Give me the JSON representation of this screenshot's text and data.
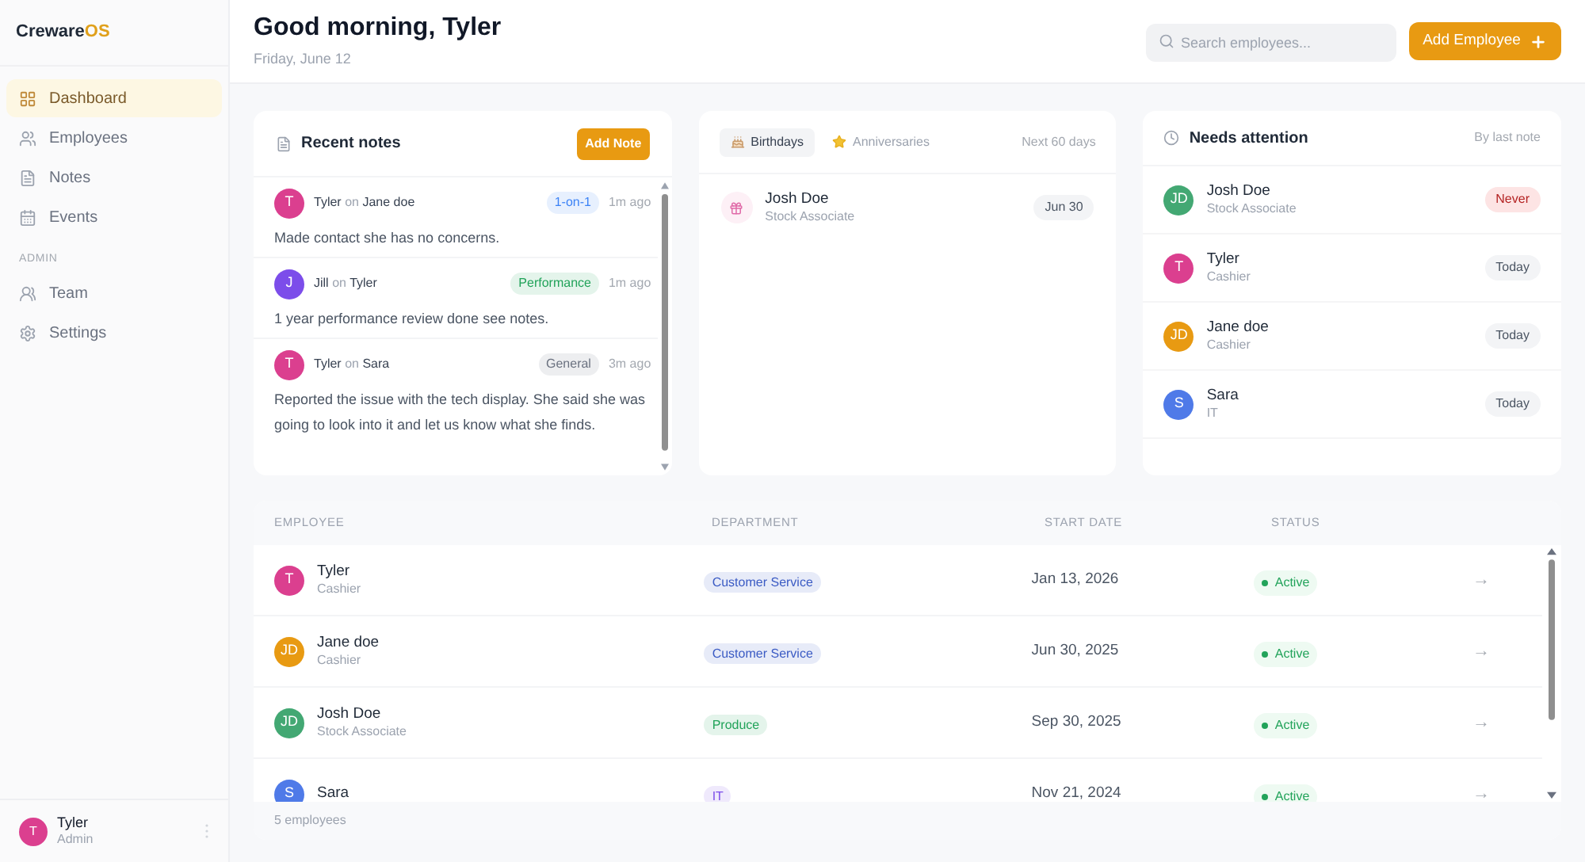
{
  "brand": {
    "name": "Creware",
    "suffix": "OS"
  },
  "sidebar": {
    "items": [
      {
        "label": "Dashboard",
        "selected": true
      },
      {
        "label": "Employees",
        "selected": false
      },
      {
        "label": "Notes",
        "selected": false
      },
      {
        "label": "Events",
        "selected": false
      }
    ],
    "section": "ADMIN",
    "admin_items": [
      {
        "label": "Team",
        "selected": false
      },
      {
        "label": "Settings",
        "selected": false
      }
    ],
    "user": {
      "initials": "T",
      "name": "Tyler",
      "role": "Admin",
      "color": "#db3f8f"
    }
  },
  "header": {
    "greeting": "Good morning, Tyler",
    "date": "Friday, June 12",
    "search": {
      "placeholder": "Search employees..."
    },
    "add_button": "Add Employee"
  },
  "recent_notes": {
    "title": "Recent notes",
    "add_button": "Add Note",
    "items": [
      {
        "initials": "T",
        "color": "#db3f8f",
        "author": "Tyler",
        "on": "on",
        "subject": "Jane doe",
        "tag": {
          "label": "1-on-1",
          "color": "#3b82f6"
        },
        "time": "1m ago",
        "text": "Made contact she has no concerns."
      },
      {
        "initials": "J",
        "color": "#7c4dea",
        "author": "Jill",
        "on": "on",
        "subject": "Tyler",
        "tag": {
          "label": "Performance",
          "color": "#22a35a"
        },
        "time": "1m ago",
        "text": "1 year performance review done see notes."
      },
      {
        "initials": "T",
        "color": "#db3f8f",
        "author": "Tyler",
        "on": "on",
        "subject": "Sara",
        "tag": {
          "label": "General",
          "color": "#6b7280"
        },
        "time": "3m ago",
        "text": "Reported the issue with the tech display. She said she was going to look into it and let us know what she finds."
      }
    ]
  },
  "events": {
    "tabs": [
      {
        "label": "Birthdays",
        "selected": true
      },
      {
        "label": "Anniversaries",
        "selected": false
      }
    ],
    "range": "Next 60 days",
    "items": [
      {
        "name": "Josh Doe",
        "role": "Stock Associate",
        "date": "Jun 30"
      }
    ]
  },
  "needs_attention": {
    "title": "Needs attention",
    "sort": "By last note",
    "items": [
      {
        "initials": "JD",
        "color": "#43a873",
        "name": "Josh Doe",
        "role": "Stock Associate",
        "badge": "Never",
        "kind": "alert"
      },
      {
        "initials": "T",
        "color": "#db3f8f",
        "name": "Tyler",
        "role": "Cashier",
        "badge": "Today",
        "kind": "ok"
      },
      {
        "initials": "JD",
        "color": "#e89a12",
        "name": "Jane doe",
        "role": "Cashier",
        "badge": "Today",
        "kind": "ok"
      },
      {
        "initials": "S",
        "color": "#4f7ae8",
        "name": "Sara",
        "role": "IT",
        "badge": "Today",
        "kind": "ok"
      }
    ]
  },
  "table": {
    "columns": [
      "EMPLOYEE",
      "DEPARTMENT",
      "START DATE",
      "STATUS"
    ],
    "rows": [
      {
        "initials": "T",
        "color": "#db3f8f",
        "name": "Tyler",
        "role": "Cashier",
        "department": {
          "label": "Customer Service",
          "color": "#3b5bc4"
        },
        "start": "Jan 13, 2026",
        "status": "Active",
        "arrow": "→"
      },
      {
        "initials": "JD",
        "color": "#e89a12",
        "name": "Jane doe",
        "role": "Cashier",
        "department": {
          "label": "Customer Service",
          "color": "#3b5bc4"
        },
        "start": "Jun 30, 2025",
        "status": "Active",
        "arrow": "→"
      },
      {
        "initials": "JD",
        "color": "#43a873",
        "name": "Josh Doe",
        "role": "Stock Associate",
        "department": {
          "label": "Produce",
          "color": "#22a35a"
        },
        "start": "Sep 30, 2025",
        "status": "Active",
        "arrow": "→"
      },
      {
        "initials": "S",
        "color": "#4f7ae8",
        "name": "Sara",
        "department": {
          "label": "IT",
          "color": "#7c4dea"
        },
        "start": "Nov 21, 2024",
        "status": "Active",
        "arrow": "→"
      }
    ],
    "footer": "5 employees"
  }
}
